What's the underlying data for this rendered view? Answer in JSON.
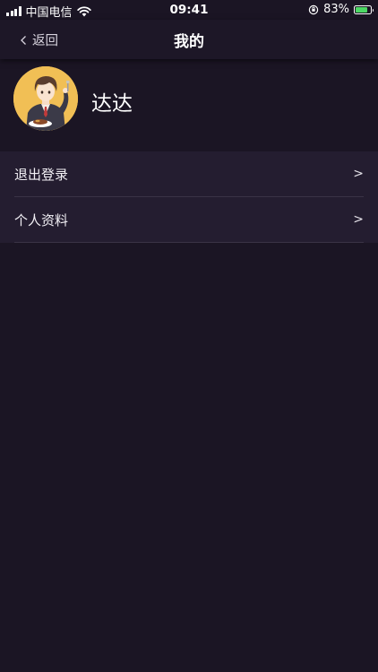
{
  "status_bar": {
    "carrier": "中国电信",
    "time": "09:41",
    "battery_percent": "83%",
    "battery_level": 0.83,
    "battery_color": "#4cd964"
  },
  "nav": {
    "back_label": "返回",
    "back_icon": "chevron-left-icon",
    "title": "我的"
  },
  "profile": {
    "avatar_icon": "avatar-illustration",
    "username": "达达"
  },
  "menu": {
    "items": [
      {
        "label": "退出登录",
        "arrow": ">"
      },
      {
        "label": "个人资料",
        "arrow": ">"
      }
    ]
  },
  "colors": {
    "background": "#1b1524",
    "nav_background": "#1d1727",
    "menu_background": "#241d30",
    "avatar_background": "#f1bf55"
  }
}
